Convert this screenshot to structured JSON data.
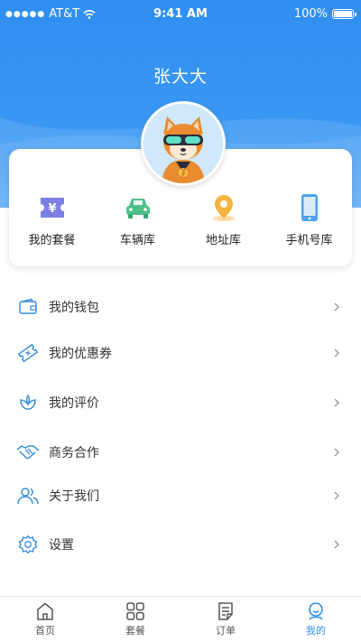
{
  "status_bar": {
    "carrier": "AT&T",
    "time": "9:41 AM",
    "battery": "100%"
  },
  "profile": {
    "name": "张大大",
    "avatar_icon": "shiba-dog-avatar-icon"
  },
  "shortcuts": [
    {
      "label": "我的套餐",
      "icon": "ticket-yen-icon",
      "color": "#7b7fe4"
    },
    {
      "label": "车辆库",
      "icon": "car-icon",
      "color": "#4fbf8a"
    },
    {
      "label": "地址库",
      "icon": "location-pin-icon",
      "color": "#f5b340"
    },
    {
      "label": "手机号库",
      "icon": "phone-icon",
      "color": "#4aa3f0"
    }
  ],
  "menu": [
    {
      "label": "我的钱包",
      "icon": "wallet-icon"
    },
    {
      "label": "我的优惠券",
      "icon": "coupon-icon"
    },
    {
      "label": "我的评价",
      "icon": "flower-icon"
    },
    {
      "label": "商务合作",
      "icon": "handshake-icon"
    },
    {
      "label": "关于我们",
      "icon": "people-icon"
    },
    {
      "label": "设置",
      "icon": "settings-gear-icon"
    }
  ],
  "tabbar": [
    {
      "label": "首页",
      "icon": "home-icon",
      "active": false
    },
    {
      "label": "套餐",
      "icon": "grid-icon",
      "active": false
    },
    {
      "label": "订单",
      "icon": "order-list-icon",
      "active": false
    },
    {
      "label": "我的",
      "icon": "user-face-icon",
      "active": true
    }
  ],
  "colors": {
    "primary": "#2f8ef0",
    "icon_blue": "#3a8fd8",
    "chevron": "#999999"
  }
}
